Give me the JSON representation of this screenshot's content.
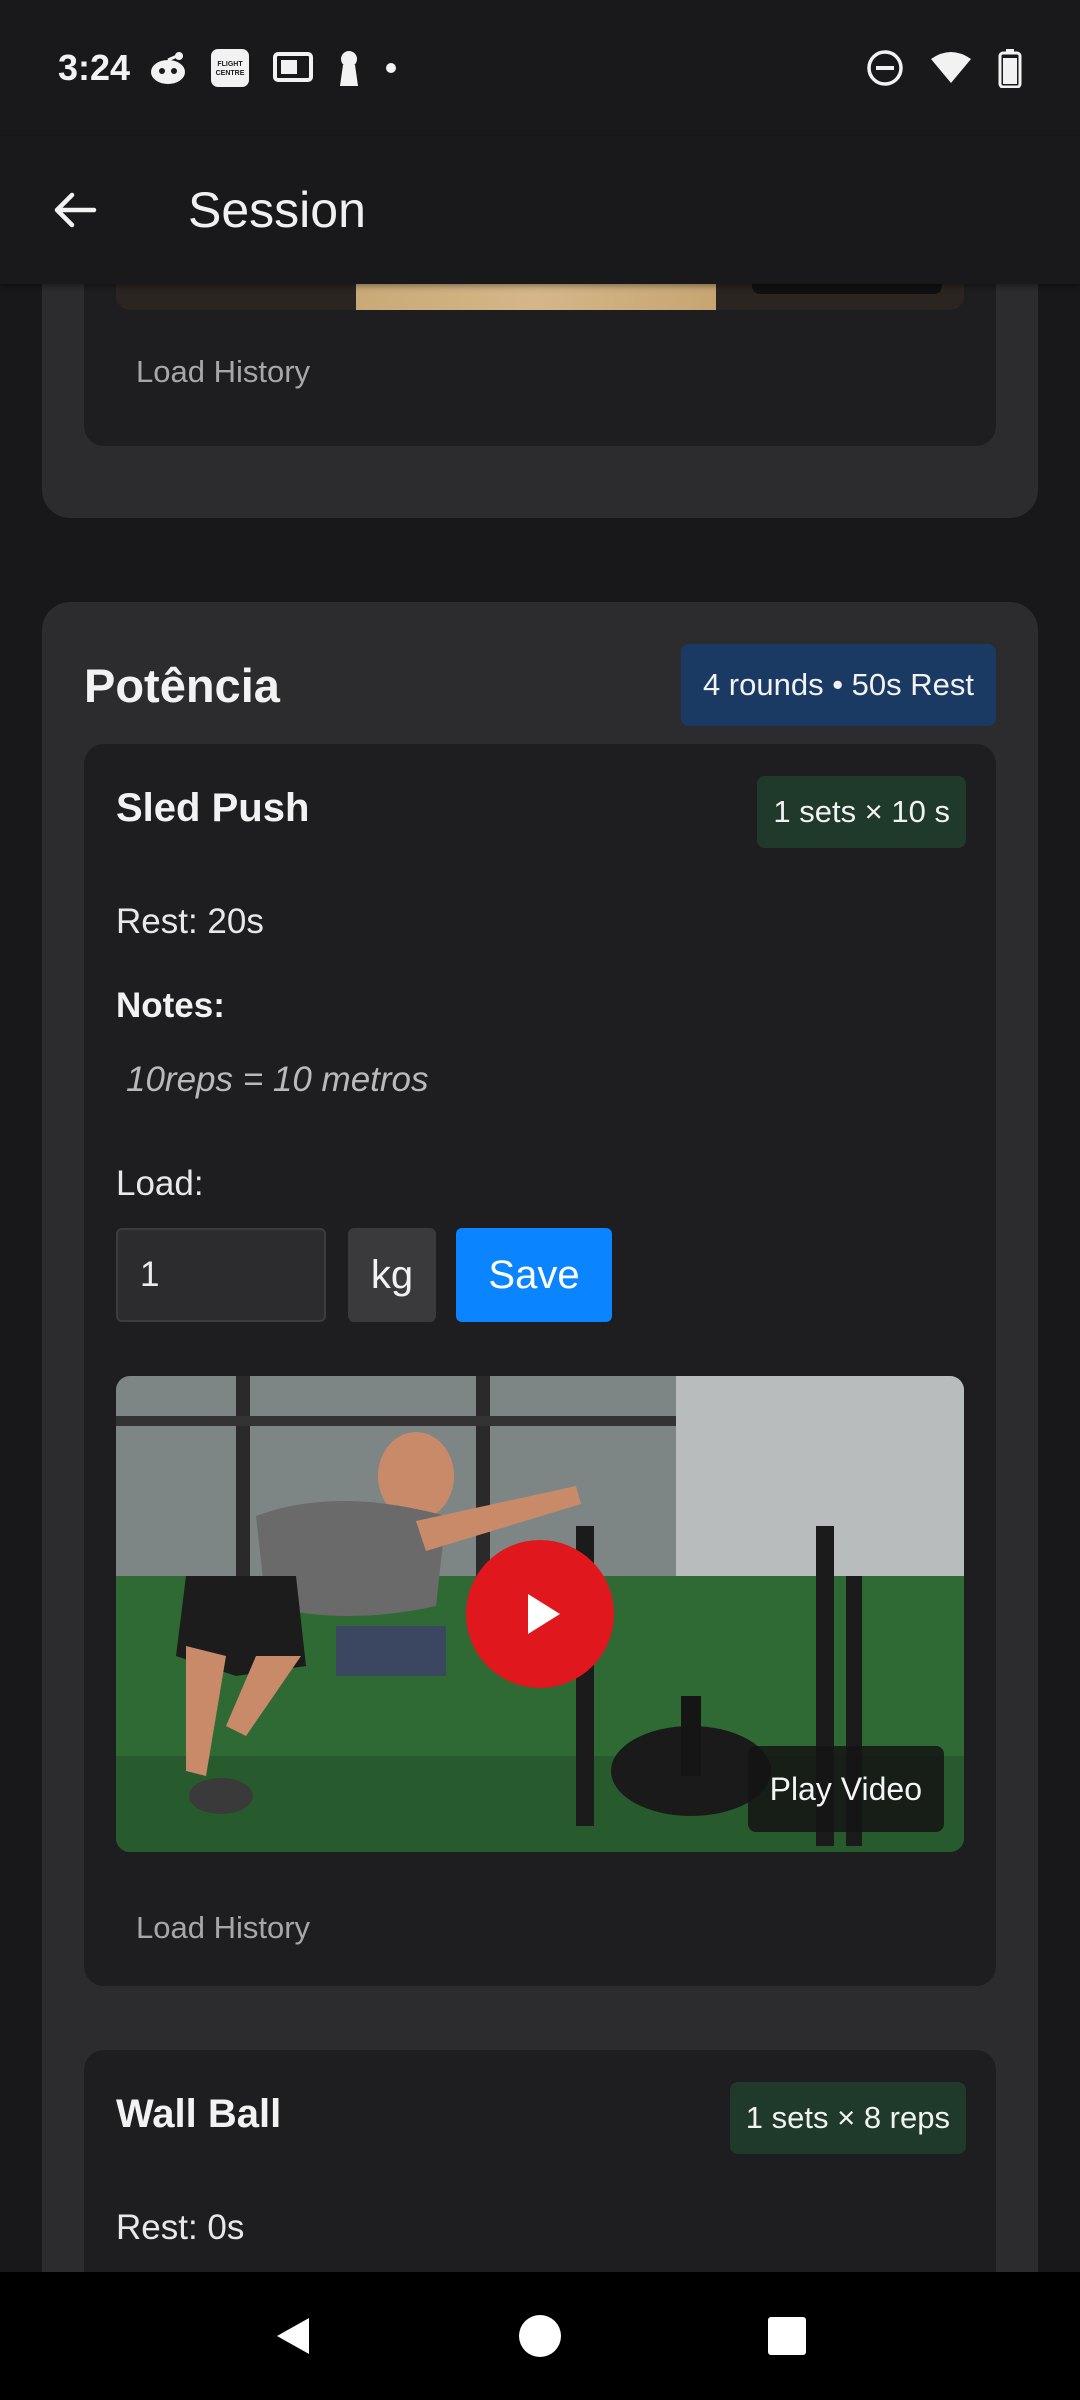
{
  "status_bar": {
    "time": "3:24",
    "left_icons": [
      "reddit-icon",
      "flight-centre-icon",
      "cast-icon",
      "keyhole-icon",
      "dot-icon"
    ],
    "flight_label": "FLIGHT CENTRE",
    "right_icons": [
      "do-not-disturb-icon",
      "wifi-icon",
      "battery-icon"
    ]
  },
  "app_bar": {
    "title": "Session",
    "back_icon": "arrow-left-icon"
  },
  "prev_section": {
    "load_history": "Load History"
  },
  "section": {
    "title": "Potência",
    "badge": "4 rounds • 50s Rest",
    "exercises": [
      {
        "title": "Sled Push",
        "sets": "1 sets × 10 s",
        "rest": "Rest: 20s",
        "notes_label": "Notes:",
        "notes": "10reps = 10 metros",
        "load_label": "Load:",
        "load_value": "1",
        "unit": "kg",
        "save_label": "Save",
        "play_video_label": "Play Video",
        "load_history": "Load History"
      },
      {
        "title": "Wall Ball",
        "sets": "1 sets × 8 reps",
        "rest": "Rest: 0s"
      }
    ]
  },
  "colors": {
    "accent": "#0a84ff",
    "rounds_badge": "#1b3a63",
    "sets_badge": "#1f3a2a",
    "play_button": "#e0171c"
  },
  "nav_bar": {
    "icons": [
      "back-triangle-icon",
      "home-circle-icon",
      "recents-square-icon"
    ]
  }
}
